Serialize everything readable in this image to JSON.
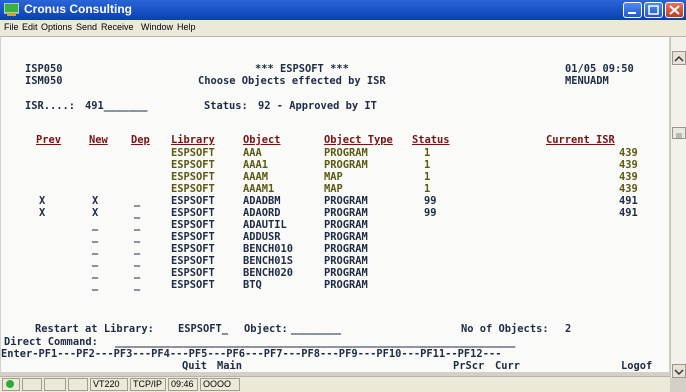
{
  "window": {
    "title": "Cronus Consulting",
    "minimize": "_",
    "maximize": "□",
    "close": "✕"
  },
  "menu": [
    "File",
    "Edit",
    "Options",
    "Send",
    "Receive",
    "Window",
    "Help"
  ],
  "terminal": {
    "program_id": "ISP050",
    "screen_id": "ISM050",
    "banner": "*** ESPSOFT ***",
    "subtitle": "Choose Objects effected by ISR",
    "date_time": "01/05 09:50",
    "menu_id": "MENUADM",
    "isr_label": "ISR....:",
    "isr_value": "491_______",
    "status_label": "Status:",
    "status_value": "92 - Approved by IT",
    "columns": [
      "Prev",
      "New",
      "Dep",
      "Library",
      "Object",
      "Object Type",
      "Status",
      "Current ISR"
    ],
    "rows": [
      {
        "prev": "",
        "new": "",
        "dep": "",
        "library": "ESPSOFT",
        "object": "AAA",
        "type": "PROGRAM",
        "status": "1",
        "isr": "439",
        "hl": true
      },
      {
        "prev": "",
        "new": "",
        "dep": "",
        "library": "ESPSOFT",
        "object": "AAA1",
        "type": "PROGRAM",
        "status": "1",
        "isr": "439",
        "hl": true
      },
      {
        "prev": "",
        "new": "",
        "dep": "",
        "library": "ESPSOFT",
        "object": "AAAM",
        "type": "MAP",
        "status": "1",
        "isr": "439",
        "hl": true
      },
      {
        "prev": "",
        "new": "",
        "dep": "",
        "library": "ESPSOFT",
        "object": "AAAM1",
        "type": "MAP",
        "status": "1",
        "isr": "439",
        "hl": true
      },
      {
        "prev": "X",
        "new": "X",
        "dep": "_",
        "library": "ESPSOFT",
        "object": "ADADBM",
        "type": "PROGRAM",
        "status": "99",
        "isr": "491",
        "hl": false
      },
      {
        "prev": "X",
        "new": "X",
        "dep": "_",
        "library": "ESPSOFT",
        "object": "ADAORD",
        "type": "PROGRAM",
        "status": "99",
        "isr": "491",
        "hl": false
      },
      {
        "prev": "",
        "new": "_",
        "dep": "_",
        "library": "ESPSOFT",
        "object": "ADAUTIL",
        "type": "PROGRAM",
        "status": "",
        "isr": "",
        "hl": false
      },
      {
        "prev": "",
        "new": "_",
        "dep": "_",
        "library": "ESPSOFT",
        "object": "ADDUSR",
        "type": "PROGRAM",
        "status": "",
        "isr": "",
        "hl": false
      },
      {
        "prev": "",
        "new": "_",
        "dep": "_",
        "library": "ESPSOFT",
        "object": "BENCH010",
        "type": "PROGRAM",
        "status": "",
        "isr": "",
        "hl": false
      },
      {
        "prev": "",
        "new": "_",
        "dep": "_",
        "library": "ESPSOFT",
        "object": "BENCH01S",
        "type": "PROGRAM",
        "status": "",
        "isr": "",
        "hl": false
      },
      {
        "prev": "",
        "new": "_",
        "dep": "_",
        "library": "ESPSOFT",
        "object": "BENCH020",
        "type": "PROGRAM",
        "status": "",
        "isr": "",
        "hl": false
      },
      {
        "prev": "",
        "new": "_",
        "dep": "_",
        "library": "ESPSOFT",
        "object": "BTQ",
        "type": "PROGRAM",
        "status": "",
        "isr": "",
        "hl": false
      }
    ],
    "restart_label": "Restart at Library:",
    "restart_value": "ESPSOFT_",
    "object_label": "Object:",
    "object_value": "________",
    "count_label": "No of Objects:",
    "count_value": "2",
    "direct_label": "Direct Command:",
    "direct_value": "________________________________________________________________",
    "pf_line": "Enter-PF1---PF2---PF3---PF4---PF5---PF6---PF7---PF8---PF9---PF10---PF11--PF12---",
    "pf_labels": [
      {
        "key": "PF3",
        "label": "Quit"
      },
      {
        "key": "PF4",
        "label": "Main"
      },
      {
        "key": "PF9",
        "label": "PrScr"
      },
      {
        "key": "PF10",
        "label": "Curr"
      },
      {
        "key": "PF12",
        "label": "Logof"
      }
    ]
  },
  "statusbar": {
    "emulation": "VT220",
    "protocol": "TCP/IP",
    "time": "09:46",
    "indicators": "OOOO"
  },
  "colors": {
    "title_bar": "#0a3fb0",
    "header": "#7a1212",
    "highlight": "#5a5a12",
    "text": "#1d2b46"
  }
}
